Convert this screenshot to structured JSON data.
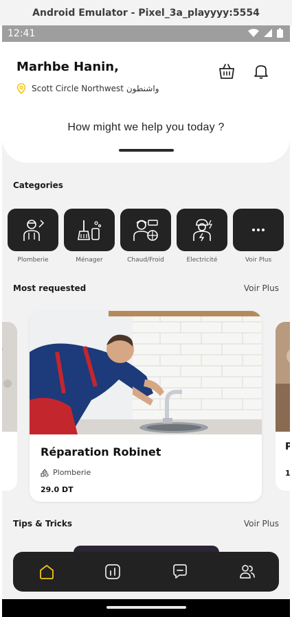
{
  "window": {
    "title": "Android Emulator - Pixel_3a_playyyy:5554"
  },
  "status_bar": {
    "time": "12:41"
  },
  "header": {
    "greeting": "Marhbe Hanin,",
    "location": "Scott Circle Northwest واشنطون",
    "help_text": "How might we help you today ?"
  },
  "categories": {
    "title": "Categories",
    "items": [
      {
        "label": "Plomberie",
        "icon": "plumber-icon"
      },
      {
        "label": "Ménager",
        "icon": "cleaning-icon"
      },
      {
        "label": "Chaud/Froid",
        "icon": "hvac-technician-icon"
      },
      {
        "label": "Electricité",
        "icon": "electrician-icon"
      },
      {
        "label": "Voir Plus",
        "icon": "more-dots-icon"
      }
    ]
  },
  "most_requested": {
    "title": "Most requested",
    "see_more": "Voir Plus",
    "card": {
      "title": "Réparation Robinet",
      "category": "Plomberie",
      "price": "29.0 DT"
    },
    "right_peek": {
      "title_fragment": "P",
      "price_fragment": "1"
    }
  },
  "tips": {
    "title": "Tips & Tricks",
    "see_more": "Voir Plus"
  },
  "bottom_nav": {
    "items": [
      "home-icon",
      "stats-icon",
      "chat-icon",
      "users-icon"
    ],
    "active_color": "#f5c518"
  },
  "colors": {
    "accent": "#f5c518",
    "dark": "#232323"
  }
}
